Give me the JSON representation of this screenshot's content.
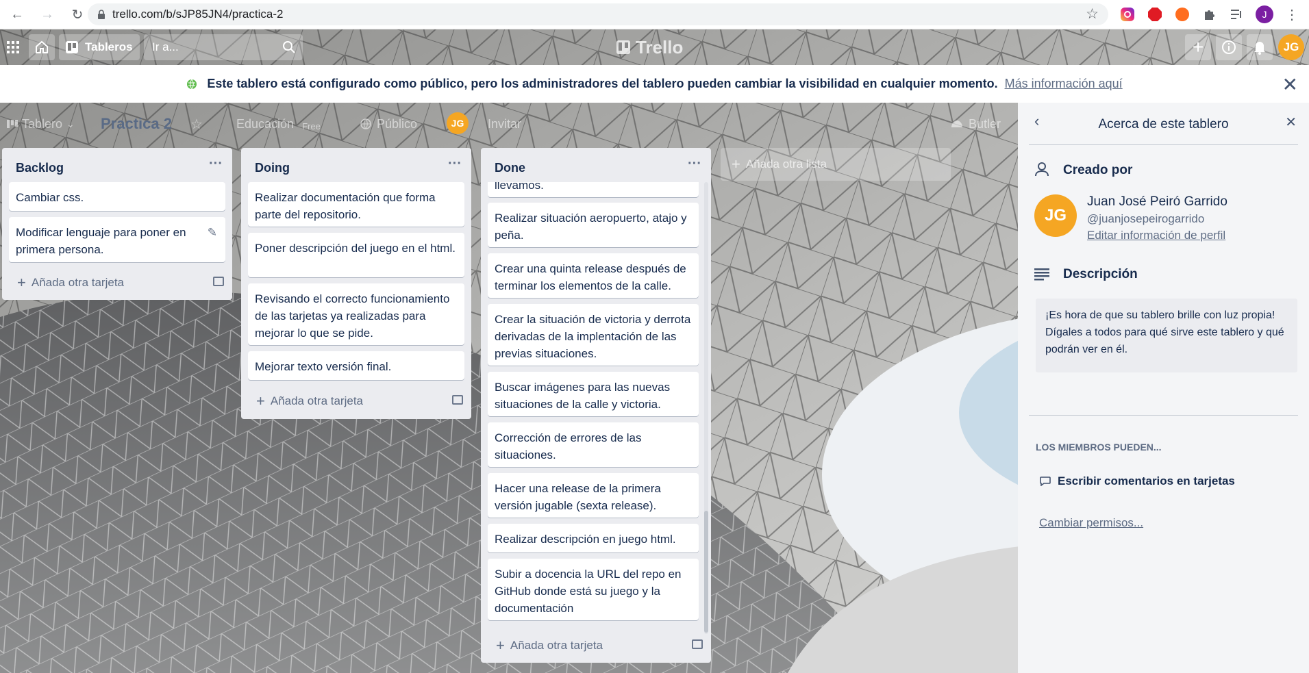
{
  "browser": {
    "url": "trello.com/b/sJP85JN4/practica-2",
    "profile_initial": "J"
  },
  "header": {
    "boards_label": "Tableros",
    "search_placeholder": "Ir a...",
    "logo_text": "Trello",
    "user_initials": "JG"
  },
  "banner": {
    "message": "Este tablero está configurado como público, pero los administradores del tablero pueden cambiar la visibilidad en cualquier momento.",
    "link": "Más información aquí"
  },
  "board": {
    "view_label": "Tablero",
    "title": "Practica 2",
    "team": "Educación",
    "team_badge": "Free",
    "visibility": "Público",
    "member_initials": "JG",
    "invite_label": "Invitar",
    "butler_label": "Butler",
    "add_list": "Añada otra lista"
  },
  "lists": [
    {
      "title": "Backlog",
      "cards": [
        "Cambiar css.",
        "Modificar lenguaje para poner en primera persona."
      ],
      "add_card": "Añada otra tarjeta"
    },
    {
      "title": "Doing",
      "cards": [
        "Realizar documentación que forma parte del repositorio.",
        "Poner descripción del juego en el html.",
        "Revisando el correcto funcionamiento de las tarjetas ya realizadas para mejorar lo que se pide.",
        "Mejorar texto versión final."
      ],
      "add_card": "Añada otra tarjeta"
    },
    {
      "title": "Done",
      "cards": [
        "llevamos.",
        "Realizar situación aeropuerto, atajo y peña.",
        "Crear una quinta release después de terminar los elementos de la calle.",
        "Crear la situación de victoria y derrota derivadas de la implentación de las previas situaciones.",
        "Buscar imágenes para las nuevas situaciones de la calle y victoria.",
        "Corrección de errores de las situaciones.",
        "Hacer una release de la primera versión jugable (sexta release).",
        "Realizar descripción en juego html.",
        "Subir a docencia la URL del repo en GitHub donde está su juego y la documentación"
      ],
      "add_card": "Añada otra tarjeta"
    }
  ],
  "sidebar": {
    "title": "Acerca de este tablero",
    "created_by_label": "Creado por",
    "creator_name": "Juan José Peiró Garrido",
    "creator_handle": "@juanjosepeirogarrido",
    "edit_profile": "Editar información de perfil",
    "creator_initials": "JG",
    "description_label": "Descripción",
    "description_text": "¡Es hora de que su tablero brille con luz propia! Dígales a todos para qué sirve este tablero y qué podrán ver en él.",
    "members_can_label": "LOS MIEMBROS PUEDEN...",
    "permission": "Escribir comentarios en tarjetas",
    "change_permissions": "Cambiar permisos..."
  },
  "colors": {
    "avatar": "#f5a623",
    "list_bg": "#ebecf0",
    "text": "#172b4d",
    "banner_icon": "#61bd4f"
  }
}
